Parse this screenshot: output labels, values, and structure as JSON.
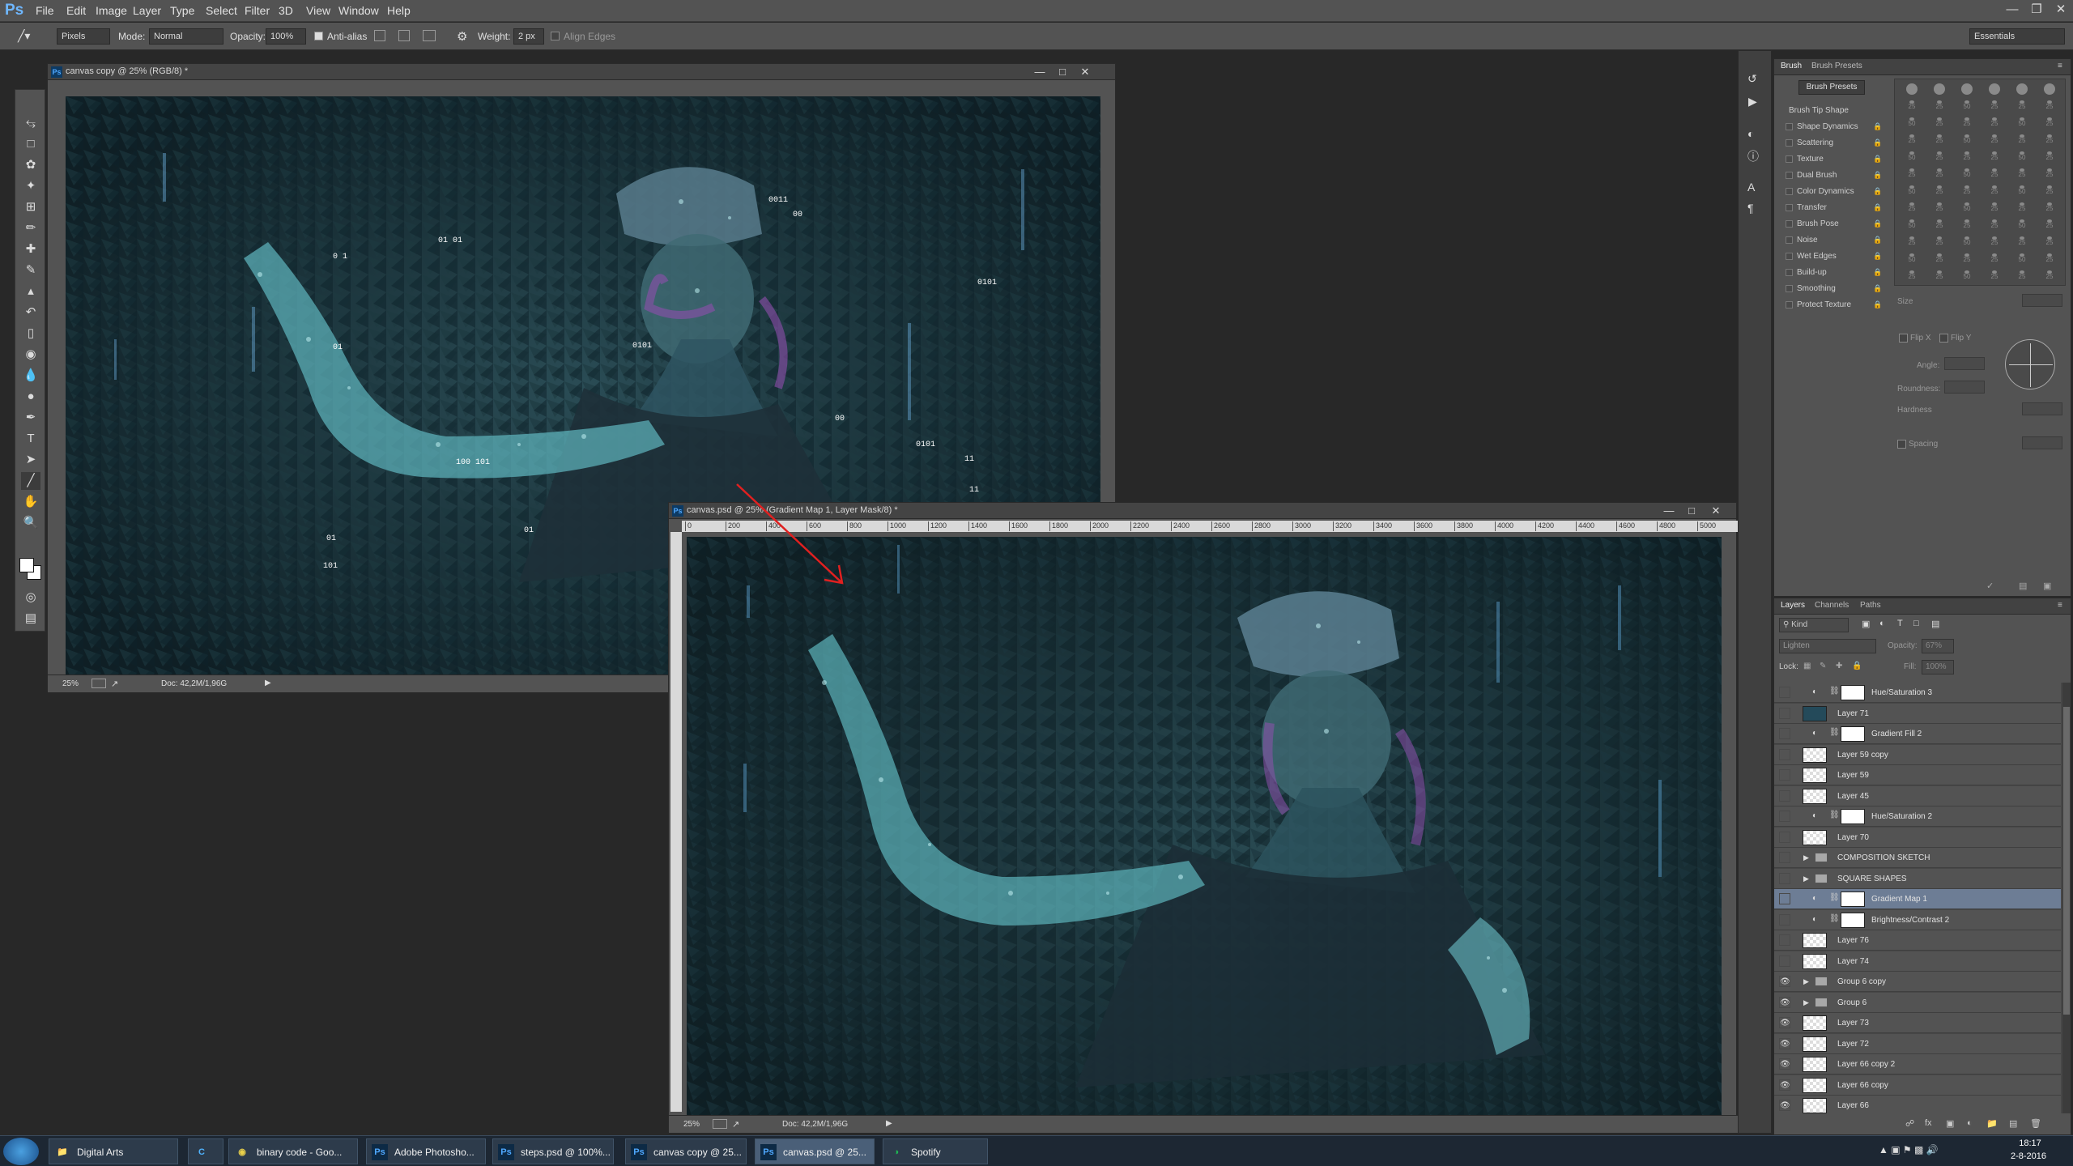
{
  "menubar": {
    "logo": "Ps",
    "items": [
      "File",
      "Edit",
      "Image",
      "Layer",
      "Type",
      "Select",
      "Filter",
      "3D",
      "View",
      "Window",
      "Help"
    ]
  },
  "options": {
    "tool_mode": "Pixels",
    "mode_label": "Mode:",
    "mode_value": "Normal",
    "opacity_label": "Opacity:",
    "opacity_value": "100%",
    "antialias_label": "Anti-alias",
    "weight_label": "Weight:",
    "weight_value": "2 px",
    "align_edges_label": "Align Edges",
    "workspace": "Essentials"
  },
  "doc1": {
    "title": "canvas copy @ 25% (RGB/8) *",
    "zoom": "25%",
    "doc_size": "Doc: 42,2M/1,96G"
  },
  "doc2": {
    "title": "canvas.psd @ 25% (Gradient Map 1, Layer Mask/8) *",
    "zoom": "25%",
    "doc_size": "Doc: 42,2M/1,96G",
    "ruler_ticks": [
      "0",
      "200",
      "400",
      "600",
      "800",
      "1000",
      "1200",
      "1400",
      "1600",
      "1800",
      "2000",
      "2200",
      "2400",
      "2600",
      "2800",
      "3000",
      "3200",
      "3400",
      "3600",
      "3800",
      "4000",
      "4200",
      "4400",
      "4600",
      "4800",
      "5000"
    ]
  },
  "binary_overlays": [
    "0011",
    "00",
    "01 01",
    "0101",
    "0 1",
    "01",
    "0101",
    "100 101",
    "01",
    "11",
    "0101",
    "01",
    "101",
    "00",
    "11"
  ],
  "brush_panel": {
    "tabs": [
      "Brush",
      "Brush Presets"
    ],
    "presets_button": "Brush Presets",
    "options": [
      "Brush Tip Shape",
      "Shape Dynamics",
      "Scattering",
      "Texture",
      "Dual Brush",
      "Color Dynamics",
      "Transfer",
      "Brush Pose",
      "Noise",
      "Wet Edges",
      "Build-up",
      "Smoothing",
      "Protect Texture"
    ],
    "preset_sizes": [
      "25",
      "50",
      "25",
      "25",
      "50",
      "25",
      "25",
      "25",
      "50",
      "25",
      "25",
      "25",
      "50",
      "25",
      "25",
      "25",
      "50",
      "25",
      "25",
      "25",
      "50",
      "25",
      "25",
      "25",
      "50",
      "25",
      "25",
      "25",
      "50",
      "25",
      "25",
      "25",
      "50",
      "25",
      "25",
      "25",
      "50",
      "25",
      "25",
      "25",
      "50",
      "25",
      "25",
      "25",
      "50",
      "25",
      "25",
      "25",
      "50",
      "25",
      "25",
      "25",
      "50",
      "25",
      "25",
      "25",
      "50",
      "25",
      "25",
      "25",
      "50",
      "25",
      "25",
      "25",
      "50",
      "25",
      "25",
      "25",
      "50",
      "25",
      "25",
      "25"
    ],
    "size_label": "Size",
    "flipx_label": "Flip X",
    "flipy_label": "Flip Y",
    "angle_label": "Angle:",
    "roundness_label": "Roundness:",
    "hardness_label": "Hardness",
    "spacing_label": "Spacing"
  },
  "layers_panel": {
    "tabs": [
      "Layers",
      "Channels",
      "Paths"
    ],
    "kind_label": "Kind",
    "blend_mode": "Lighten",
    "opacity_label": "Opacity:",
    "opacity_value": "67%",
    "lock_label": "Lock:",
    "fill_label": "Fill:",
    "fill_value": "100%",
    "layers": [
      {
        "name": "Hue/Saturation 3",
        "type": "adjustment",
        "visible": false
      },
      {
        "name": "Layer 71",
        "type": "pixel",
        "visible": false
      },
      {
        "name": "Gradient Fill 2",
        "type": "adjustment",
        "visible": false
      },
      {
        "name": "Layer 59 copy",
        "type": "pixel",
        "visible": false
      },
      {
        "name": "Layer 59",
        "type": "pixel",
        "visible": false
      },
      {
        "name": "Layer 45",
        "type": "pixel",
        "visible": false
      },
      {
        "name": "Hue/Saturation 2",
        "type": "adjustment",
        "visible": false
      },
      {
        "name": "Layer 70",
        "type": "pixel",
        "visible": false
      },
      {
        "name": "COMPOSITION SKETCH",
        "type": "group",
        "visible": false
      },
      {
        "name": "SQUARE SHAPES",
        "type": "group",
        "visible": false
      },
      {
        "name": "Gradient Map 1",
        "type": "adjustment",
        "visible": false,
        "selected": true
      },
      {
        "name": "Brightness/Contrast 2",
        "type": "adjustment",
        "visible": false
      },
      {
        "name": "Layer 76",
        "type": "pixel",
        "visible": false
      },
      {
        "name": "Layer 74",
        "type": "pixel",
        "visible": false
      },
      {
        "name": "Group 6 copy",
        "type": "group",
        "visible": true
      },
      {
        "name": "Group 6",
        "type": "group",
        "visible": true
      },
      {
        "name": "Layer 73",
        "type": "pixel",
        "visible": true
      },
      {
        "name": "Layer 72",
        "type": "pixel",
        "visible": true
      },
      {
        "name": "Layer 66 copy 2",
        "type": "pixel",
        "visible": true
      },
      {
        "name": "Layer 66 copy",
        "type": "pixel",
        "visible": true
      },
      {
        "name": "Layer 66",
        "type": "pixel",
        "visible": true
      }
    ]
  },
  "taskbar": {
    "items": [
      {
        "label": "Digital Arts",
        "icon": "folder-icon"
      },
      {
        "label": "",
        "icon": "ccleaner-icon"
      },
      {
        "label": "binary code - Goo...",
        "icon": "chrome-icon"
      },
      {
        "label": "Adobe Photosho...",
        "icon": "photoshop-icon"
      },
      {
        "label": "steps.psd @ 100%...",
        "icon": "photoshop-icon"
      },
      {
        "label": "canvas copy @ 25...",
        "icon": "photoshop-icon"
      },
      {
        "label": "canvas.psd @ 25...",
        "icon": "photoshop-icon"
      },
      {
        "label": "Spotify",
        "icon": "spotify-icon"
      }
    ],
    "time": "18:17",
    "date": "2-8-2016"
  },
  "colors": {
    "chrome_bg": "#535353",
    "workspace_bg": "#282828",
    "selected_layer": "#6d7d95",
    "artwork_dark": "#13252b",
    "accent_cyan": "#7fe0e6"
  }
}
